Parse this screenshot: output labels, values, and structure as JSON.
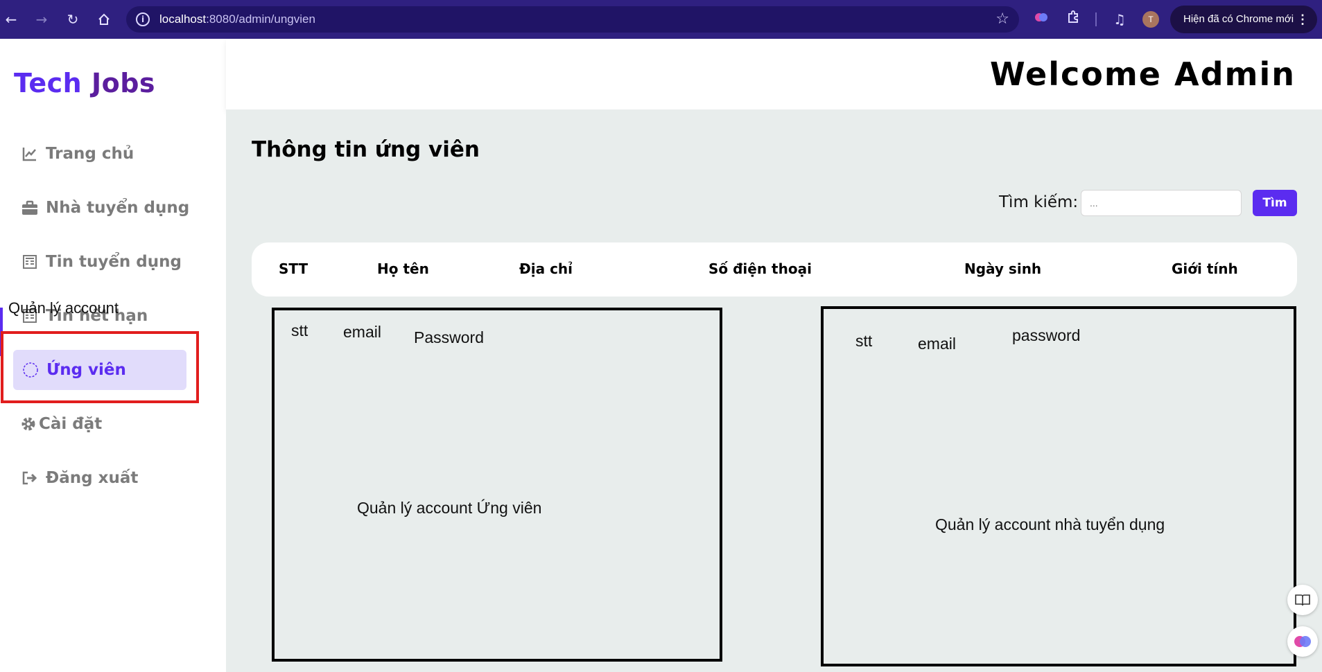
{
  "browser": {
    "url_host": "localhost",
    "url_path": ":8080/admin/ungvien",
    "chrome_update_label": "Hiện đã có Chrome mới",
    "profile_initial": "T"
  },
  "sidebar": {
    "brand_part1": "Tech",
    "brand_part2": "Jobs",
    "overlay_label": "Quản lý account",
    "items": [
      {
        "label": "Trang chủ",
        "icon": "chart-line-icon"
      },
      {
        "label": "Nhà tuyển dụng",
        "icon": "briefcase-icon"
      },
      {
        "label": "Tin tuyển dụng",
        "icon": "newspaper-icon"
      },
      {
        "label": "Tin hết hạn",
        "icon": "newspaper-icon"
      },
      {
        "label": "Ứng viên",
        "icon": "dashed-circle-icon",
        "active": true
      },
      {
        "label": "Cài đặt",
        "icon": "gear-icon"
      },
      {
        "label": "Đăng xuất",
        "icon": "logout-icon"
      }
    ]
  },
  "header": {
    "welcome": "Welcome Admin"
  },
  "main": {
    "title": "Thông tin ứng viên",
    "search": {
      "label": "Tìm kiếm:",
      "placeholder": "...",
      "button_label": "Tìm"
    },
    "table_headers": [
      "STT",
      "Họ tên",
      "Địa chỉ",
      "Số điện thoại",
      "Ngày sinh",
      "Giới tính"
    ],
    "left_box": {
      "columns": [
        "stt",
        "email",
        "Password"
      ],
      "caption": "Quản lý account Ứng viên"
    },
    "right_box": {
      "columns": [
        "stt",
        "email",
        "password"
      ],
      "caption": "Quản lý account nhà tuyển dụng"
    }
  },
  "colors": {
    "accent": "#5b2cf0",
    "chrome_bg": "#2f2080",
    "main_bg": "#e8edec",
    "highlight_red": "#e11d1d"
  }
}
